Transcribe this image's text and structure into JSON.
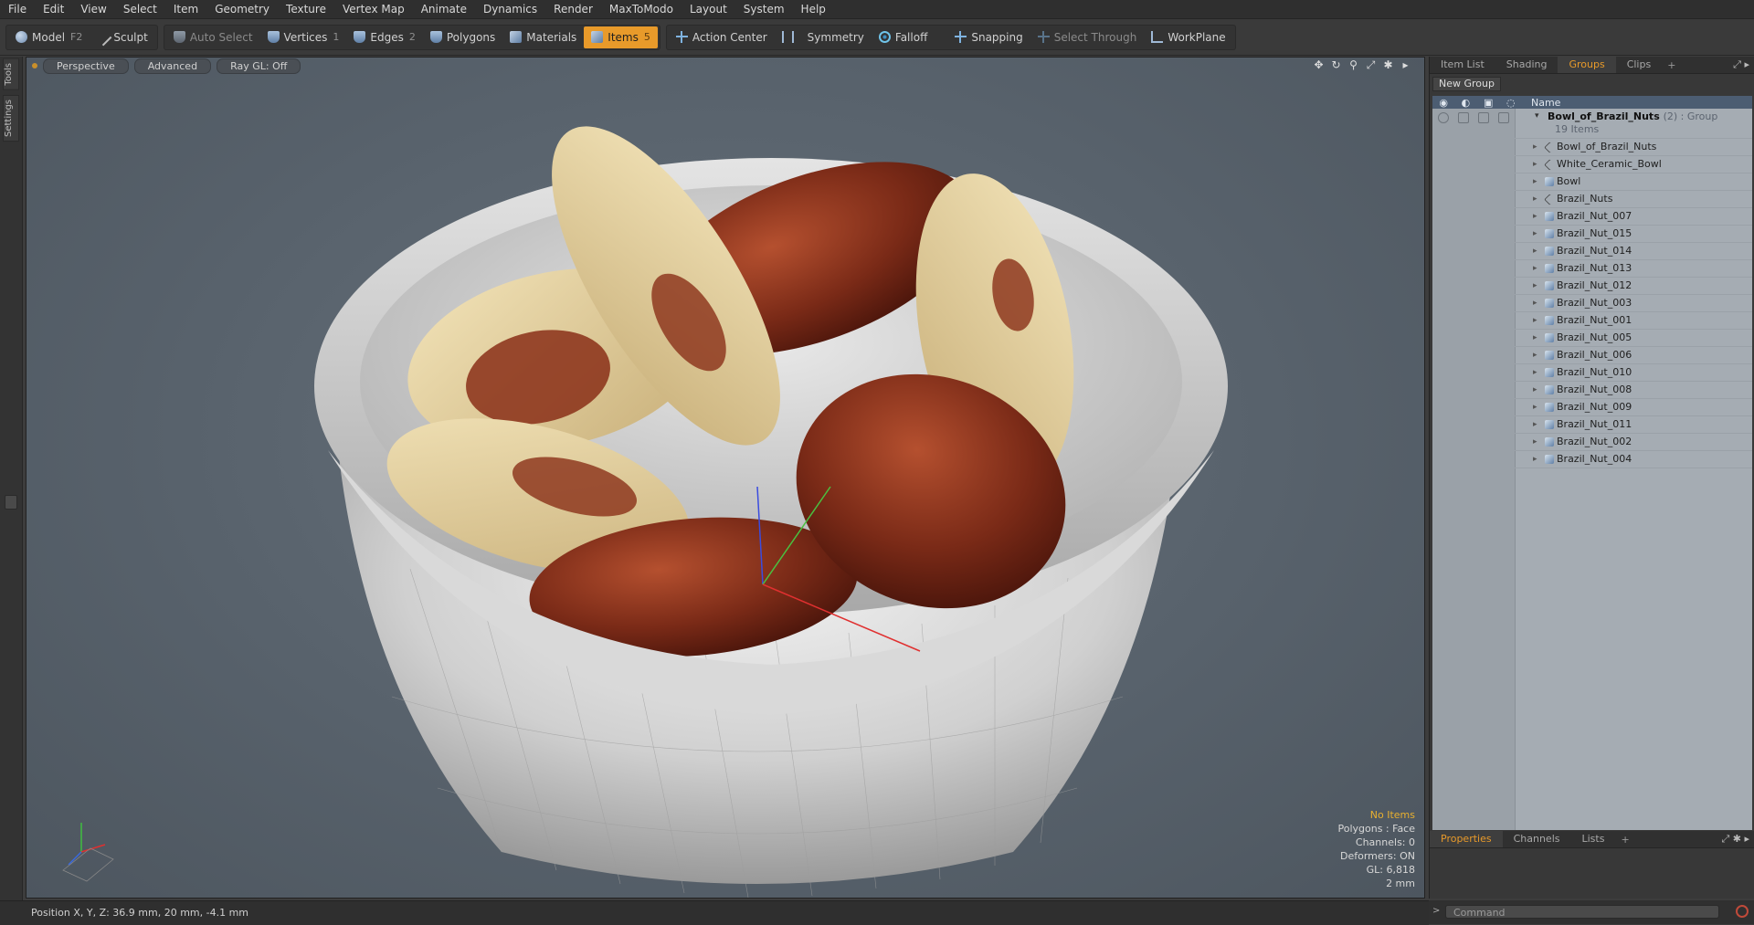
{
  "menu": [
    "File",
    "Edit",
    "View",
    "Select",
    "Item",
    "Geometry",
    "Texture",
    "Vertex Map",
    "Animate",
    "Dynamics",
    "Render",
    "MaxToModo",
    "Layout",
    "System",
    "Help"
  ],
  "toolbar": {
    "model": "Model",
    "model_key": "F2",
    "sculpt": "Sculpt",
    "auto_select": "Auto Select",
    "vertices": "Vertices",
    "vertices_key": "1",
    "edges": "Edges",
    "edges_key": "2",
    "polygons": "Polygons",
    "materials": "Materials",
    "items": "Items",
    "items_key": "5",
    "action_center": "Action Center",
    "symmetry": "Symmetry",
    "falloff": "Falloff",
    "snapping": "Snapping",
    "select_through": "Select Through",
    "workplane": "WorkPlane"
  },
  "left_tabs": {
    "tools": "Tools",
    "settings": "Settings"
  },
  "viewport": {
    "perspective": "Perspective",
    "advanced": "Advanced",
    "raygl": "Ray GL: Off",
    "stats": {
      "no_items": "No Items",
      "polygons": "Polygons : Face",
      "channels": "Channels: 0",
      "deformers": "Deformers: ON",
      "gl": "GL: 6,818",
      "unit": "2 mm"
    }
  },
  "right_tabs": {
    "item_list": "Item List",
    "shading": "Shading",
    "groups": "Groups",
    "clips": "Clips"
  },
  "groups_panel": {
    "new_group": "New Group",
    "col_name": "Name",
    "group_name": "Bowl_of_Brazil_Nuts",
    "group_meta": "(2) : Group",
    "group_count": "19 Items",
    "items": [
      {
        "name": "Bowl_of_Brazil_Nuts",
        "type": "locator"
      },
      {
        "name": "White_Ceramic_Bowl",
        "type": "locator"
      },
      {
        "name": "Bowl",
        "type": "mesh"
      },
      {
        "name": "Brazil_Nuts",
        "type": "locator"
      },
      {
        "name": "Brazil_Nut_007",
        "type": "mesh"
      },
      {
        "name": "Brazil_Nut_015",
        "type": "mesh"
      },
      {
        "name": "Brazil_Nut_014",
        "type": "mesh"
      },
      {
        "name": "Brazil_Nut_013",
        "type": "mesh"
      },
      {
        "name": "Brazil_Nut_012",
        "type": "mesh"
      },
      {
        "name": "Brazil_Nut_003",
        "type": "mesh"
      },
      {
        "name": "Brazil_Nut_001",
        "type": "mesh"
      },
      {
        "name": "Brazil_Nut_005",
        "type": "mesh"
      },
      {
        "name": "Brazil_Nut_006",
        "type": "mesh"
      },
      {
        "name": "Brazil_Nut_010",
        "type": "mesh"
      },
      {
        "name": "Brazil_Nut_008",
        "type": "mesh"
      },
      {
        "name": "Brazil_Nut_009",
        "type": "mesh"
      },
      {
        "name": "Brazil_Nut_011",
        "type": "mesh"
      },
      {
        "name": "Brazil_Nut_002",
        "type": "mesh"
      },
      {
        "name": "Brazil_Nut_004",
        "type": "mesh"
      }
    ]
  },
  "props_tabs": {
    "properties": "Properties",
    "channels": "Channels",
    "lists": "Lists"
  },
  "command": {
    "placeholder": "Command"
  },
  "status": {
    "position": "Position X, Y, Z:   36.9 mm, 20 mm, -4.1 mm"
  },
  "colors": {
    "accent": "#e89a2a",
    "list_bg": "#a5acb3",
    "header_blue": "#4c5d72"
  }
}
